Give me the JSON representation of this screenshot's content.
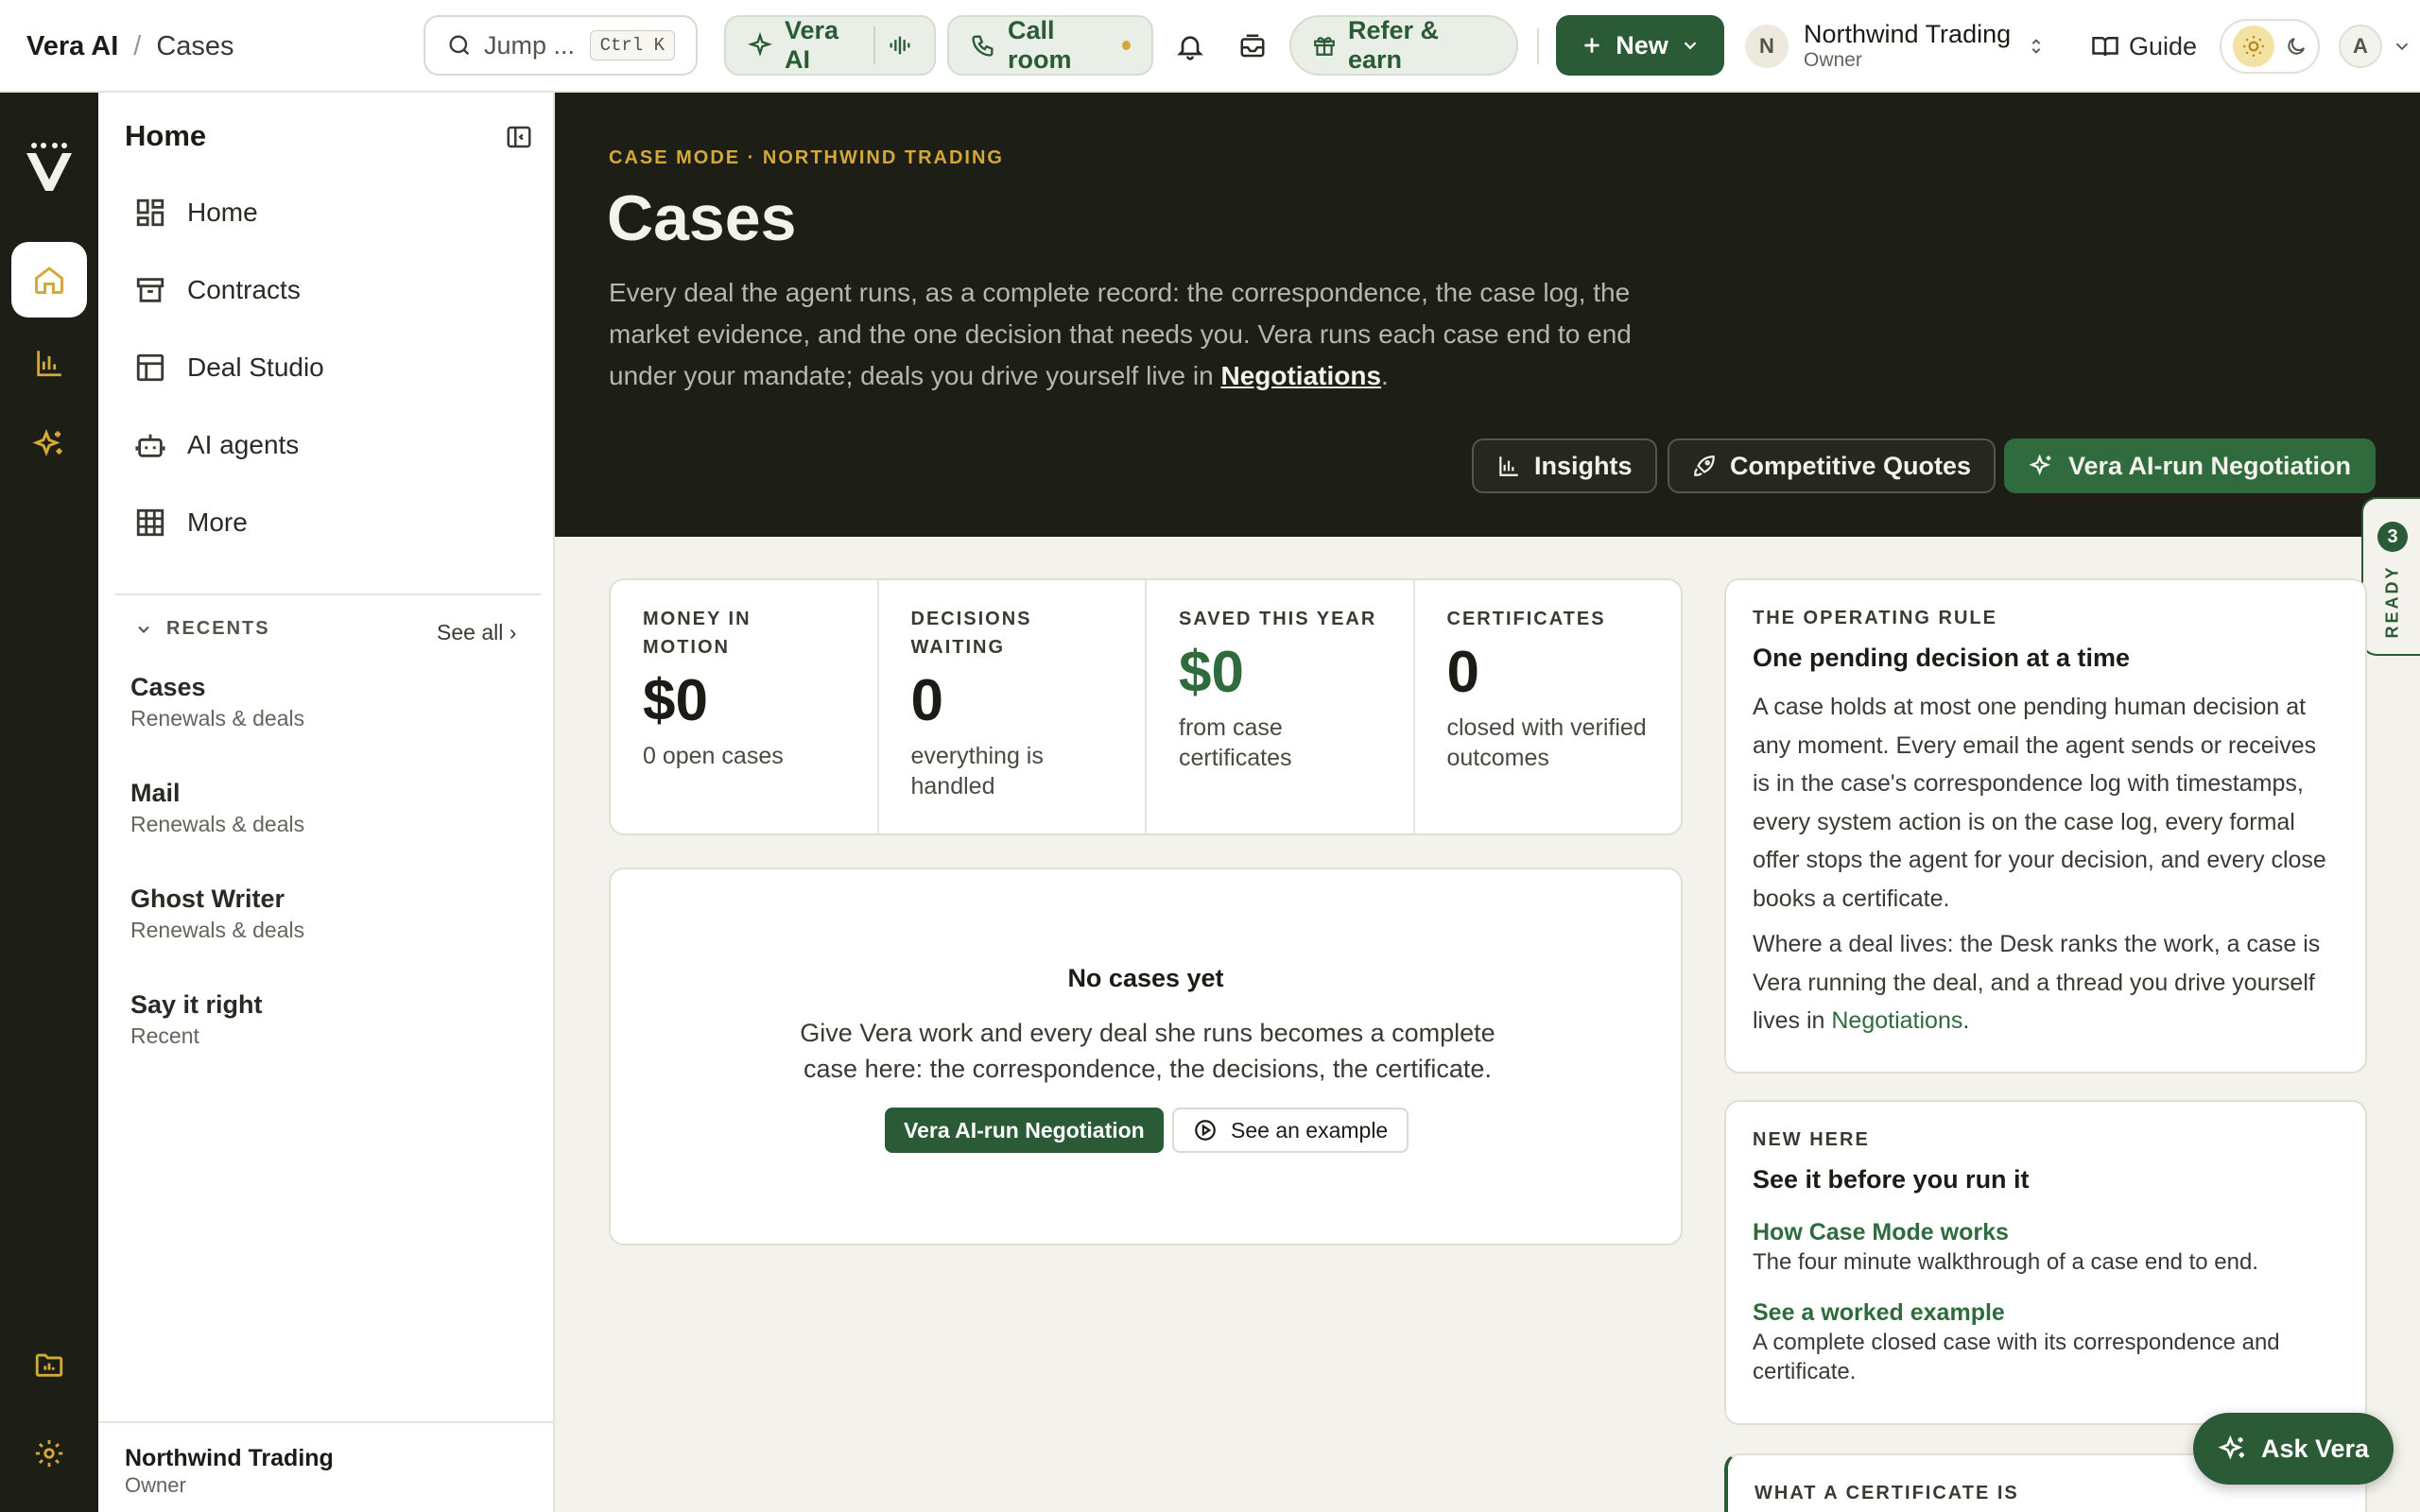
{
  "breadcrumb": {
    "app": "Vera AI",
    "separator": "/",
    "current": "Cases"
  },
  "topbar": {
    "search_label": "Jump ...",
    "search_shortcut": "Ctrl K",
    "vera_label": "Vera AI",
    "call_label": "Call room",
    "refer_label": "Refer & earn",
    "new_label": "New",
    "org_initial": "N",
    "org_name": "Northwind Trading",
    "org_role": "Owner",
    "guide_label": "Guide",
    "user_initial": "A"
  },
  "sidebar": {
    "title": "Home",
    "items": [
      {
        "label": "Home",
        "icon": "dashboard-icon"
      },
      {
        "label": "Contracts",
        "icon": "archive-icon"
      },
      {
        "label": "Deal Studio",
        "icon": "layout-icon"
      },
      {
        "label": "AI agents",
        "icon": "bot-icon"
      },
      {
        "label": "More",
        "icon": "grid-icon"
      }
    ],
    "recents_label": "RECENTS",
    "see_all": "See all ›",
    "recents": [
      {
        "title": "Cases",
        "subtitle": "Renewals & deals"
      },
      {
        "title": "Mail",
        "subtitle": "Renewals & deals"
      },
      {
        "title": "Ghost Writer",
        "subtitle": "Renewals & deals"
      },
      {
        "title": "Say it right",
        "subtitle": "Recent"
      }
    ],
    "footer_name": "Northwind Trading",
    "footer_role": "Owner"
  },
  "hero": {
    "eyebrow": "CASE MODE · NORTHWIND TRADING",
    "title": "Cases",
    "description": "Every deal the agent runs, as a complete record: the correspondence, the case log, the market evidence, and the one decision that needs you. Vera runs each case end to end under your mandate; deals you drive yourself live in ",
    "description_link": "Negotiations",
    "description_end": ".",
    "buttons": [
      "Insights",
      "Competitive Quotes",
      "Vera AI-run Negotiation"
    ]
  },
  "ready_tab": {
    "count": "3",
    "label": "READY"
  },
  "stats": [
    {
      "label": "MONEY IN MOTION",
      "value": "$0",
      "sub": "0 open cases"
    },
    {
      "label": "DECISIONS WAITING",
      "value": "0",
      "sub": "everything is handled"
    },
    {
      "label": "SAVED THIS YEAR",
      "value": "$0",
      "sub": "from case certificates"
    },
    {
      "label": "CERTIFICATES",
      "value": "0",
      "sub": "closed with verified outcomes"
    }
  ],
  "empty_state": {
    "title": "No cases yet",
    "description": "Give Vera work and every deal she runs becomes a complete case here: the correspondence, the decisions, the certificate.",
    "primary_button": "Vera AI-run Negotiation",
    "secondary_button": "See an example"
  },
  "operating_rule": {
    "label": "THE OPERATING RULE",
    "title": "One pending decision at a time",
    "para1": "A case holds at most one pending human decision at any moment. Every email the agent sends or receives is in the case's correspondence log with timestamps, every system action is on the case log, every formal offer stops the agent for your decision, and every close books a certificate.",
    "para2": "Where a deal lives: the Desk ranks the work, a case is Vera running the deal, and a thread you drive yourself lives in ",
    "para2_link": "Negotiations",
    "para2_end": "."
  },
  "new_here": {
    "label": "NEW HERE",
    "title": "See it before you run it",
    "links": [
      {
        "title": "How Case Mode works",
        "desc": "The four minute walkthrough of a case end to end."
      },
      {
        "title": "See a worked example",
        "desc": "A complete closed case with its correspondence and certificate."
      }
    ]
  },
  "certificate_card": {
    "label": "WHAT A CERTIFICATE IS"
  },
  "ask_vera": "Ask Vera",
  "colors": {
    "brand_green": "#2b5a36",
    "accent_gold": "#d4a93a",
    "dark_bg": "#1d1f17"
  }
}
